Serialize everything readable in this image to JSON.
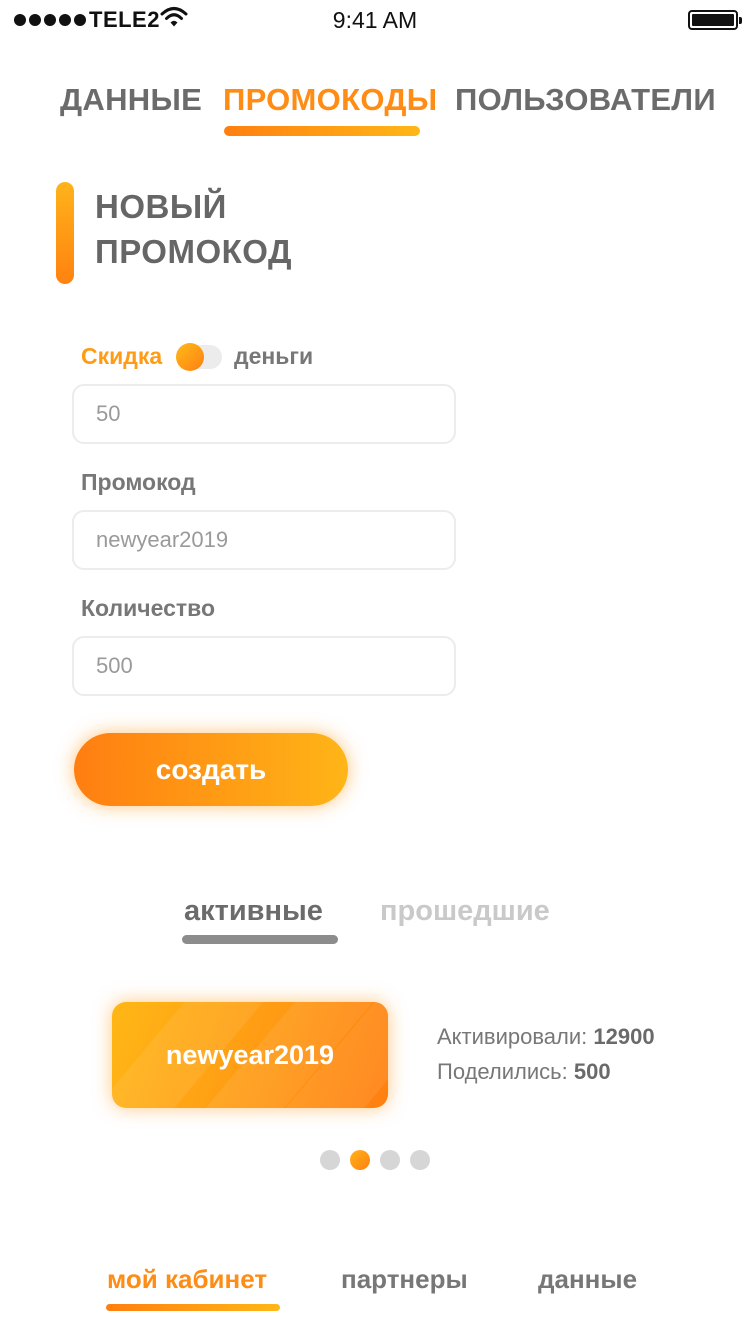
{
  "status_bar": {
    "carrier": "TELE2",
    "time": "9:41 AM"
  },
  "top_tabs": [
    {
      "label": "ДАННЫЕ",
      "active": false
    },
    {
      "label": "ПРОМОКОДЫ",
      "active": true
    },
    {
      "label": "ПОЛЬЗОВАТЕЛИ",
      "active": false
    }
  ],
  "section": {
    "title_line1": "НОВЫЙ",
    "title_line2": "ПРОМОКОД"
  },
  "form": {
    "discount_label": "Скидка",
    "money_label": "деньги",
    "discount_value": "50",
    "promo_label": "Промокод",
    "promo_value": "newyear2019",
    "quantity_label": "Количество",
    "quantity_value": "500",
    "create_button": "создать"
  },
  "list_tabs": [
    {
      "label": "активные",
      "active": true
    },
    {
      "label": "прошедшие",
      "active": false
    }
  ],
  "promo_card": {
    "code": "newyear2019",
    "activated_label": "Активировали:",
    "activated_value": "12900",
    "shared_label": "Поделились:",
    "shared_value": "500"
  },
  "pager": {
    "count": 4,
    "active_index": 1
  },
  "bottom_nav": [
    {
      "label": "мой кабинет",
      "active": true
    },
    {
      "label": "партнеры",
      "active": false
    },
    {
      "label": "данные",
      "active": false
    }
  ],
  "colors": {
    "accent_start": "#ff7e11",
    "accent_end": "#ffb517",
    "text_gray": "#6e6e6e",
    "inactive_gray": "#c9c9c9"
  }
}
